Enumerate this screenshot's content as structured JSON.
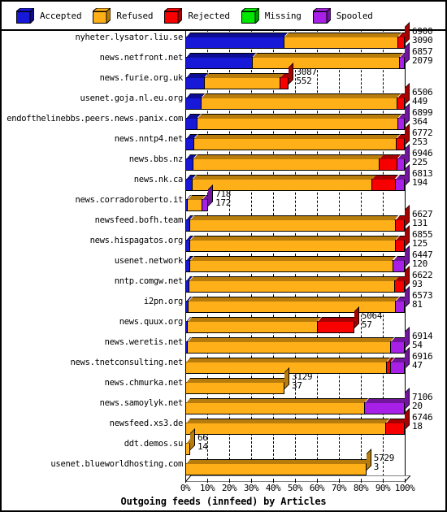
{
  "title": "Outgoing feeds (innfeed) by Articles",
  "colors": {
    "accepted": "#1818d8",
    "accepted_dark": "#0d0d93",
    "refused": "#ffb018",
    "refused_dark": "#b87c0c",
    "rejected": "#f80000",
    "rejected_dark": "#a80000",
    "missing": "#00e800",
    "missing_dark": "#009c00",
    "spooled": "#a820e8",
    "spooled_dark": "#70159c",
    "background": "#ffffff",
    "outline": "#000000"
  },
  "legend": {
    "items": [
      {
        "label": "Accepted",
        "key": "accepted"
      },
      {
        "label": "Refused",
        "key": "refused"
      },
      {
        "label": "Rejected",
        "key": "rejected"
      },
      {
        "label": "Missing",
        "key": "missing"
      },
      {
        "label": "Spooled",
        "key": "spooled"
      }
    ]
  },
  "chart_data": {
    "type": "bar",
    "orientation": "horizontal",
    "stacked": true,
    "title": "Outgoing feeds (innfeed) by Articles",
    "xlabel": "",
    "ylabel": "",
    "xlim": [
      0,
      100
    ],
    "x_tick_labels": [
      "0%",
      "10%",
      "20%",
      "30%",
      "40%",
      "50%",
      "60%",
      "70%",
      "80%",
      "90%",
      "100%"
    ],
    "x_tick_values": [
      0,
      10,
      20,
      30,
      40,
      50,
      60,
      70,
      80,
      90,
      100
    ],
    "grid": true,
    "legend_position": "top",
    "series_names": [
      "Accepted",
      "Refused",
      "Rejected",
      "Missing",
      "Spooled"
    ],
    "categories": [
      "nyheter.lysator.liu.se",
      "news.netfront.net",
      "news.furie.org.uk",
      "usenet.goja.nl.eu.org",
      "endofthelinebbs.peers.news.panix.com",
      "news.nntp4.net",
      "news.bbs.nz",
      "news.nk.ca",
      "news.corradoroberto.it",
      "newsfeed.bofh.team",
      "news.hispagatos.org",
      "usenet.network",
      "nntp.comgw.net",
      "i2pn.org",
      "news.quux.org",
      "news.weretis.net",
      "news.tnetconsulting.net",
      "news.chmurka.net",
      "news.samoylyk.net",
      "newsfeed.xs3.de",
      "ddt.demos.su",
      "usenet.blueworldhosting.com"
    ],
    "rows": [
      {
        "label": "nyheter.lysator.liu.se",
        "total": 6900,
        "secondary": 3090,
        "pct": 100.0,
        "segments": [
          {
            "key": "accepted",
            "pct": 44.8
          },
          {
            "key": "refused",
            "pct": 51.7
          },
          {
            "key": "rejected",
            "pct": 3.5
          }
        ]
      },
      {
        "label": "news.netfront.net",
        "total": 6857,
        "secondary": 2079,
        "pct": 100.0,
        "segments": [
          {
            "key": "accepted",
            "pct": 30.3
          },
          {
            "key": "refused",
            "pct": 67.2
          },
          {
            "key": "spooled",
            "pct": 2.5
          }
        ]
      },
      {
        "label": "news.furie.org.uk",
        "total": 3087,
        "secondary": 552,
        "pct": 47.2,
        "segments": [
          {
            "key": "accepted",
            "pct": 17.9
          },
          {
            "key": "refused",
            "pct": 73.5
          },
          {
            "key": "rejected",
            "pct": 8.6
          }
        ]
      },
      {
        "label": "usenet.goja.nl.eu.org",
        "total": 6506,
        "secondary": 449,
        "pct": 100.0,
        "segments": [
          {
            "key": "accepted",
            "pct": 6.9
          },
          {
            "key": "refused",
            "pct": 89.4
          },
          {
            "key": "rejected",
            "pct": 3.7
          }
        ]
      },
      {
        "label": "endofthelinebbs.peers.news.panix.com",
        "total": 6899,
        "secondary": 364,
        "pct": 100.0,
        "segments": [
          {
            "key": "accepted",
            "pct": 5.3
          },
          {
            "key": "refused",
            "pct": 91.4
          },
          {
            "key": "spooled",
            "pct": 3.3
          }
        ]
      },
      {
        "label": "news.nntp4.net",
        "total": 6772,
        "secondary": 253,
        "pct": 100.0,
        "segments": [
          {
            "key": "accepted",
            "pct": 3.7
          },
          {
            "key": "refused",
            "pct": 92.1
          },
          {
            "key": "rejected",
            "pct": 4.2
          }
        ]
      },
      {
        "label": "news.bbs.nz",
        "total": 6946,
        "secondary": 225,
        "pct": 100.0,
        "segments": [
          {
            "key": "accepted",
            "pct": 3.2
          },
          {
            "key": "refused",
            "pct": 85.0
          },
          {
            "key": "rejected",
            "pct": 8.0
          },
          {
            "key": "spooled",
            "pct": 3.8
          }
        ]
      },
      {
        "label": "news.nk.ca",
        "total": 6813,
        "secondary": 194,
        "pct": 100.0,
        "segments": [
          {
            "key": "accepted",
            "pct": 2.8
          },
          {
            "key": "refused",
            "pct": 82.2
          },
          {
            "key": "rejected",
            "pct": 10.5
          },
          {
            "key": "spooled",
            "pct": 4.5
          }
        ]
      },
      {
        "label": "news.corradoroberto.it",
        "total": 718,
        "secondary": 172,
        "pct": 10.4,
        "segments": [
          {
            "key": "accepted",
            "pct": 2.5
          },
          {
            "key": "refused",
            "pct": 67.5
          },
          {
            "key": "spooled",
            "pct": 30.0
          }
        ]
      },
      {
        "label": "newsfeed.bofh.team",
        "total": 6627,
        "secondary": 131,
        "pct": 100.0,
        "segments": [
          {
            "key": "accepted",
            "pct": 2.0
          },
          {
            "key": "refused",
            "pct": 93.5
          },
          {
            "key": "rejected",
            "pct": 4.5
          }
        ]
      },
      {
        "label": "news.hispagatos.org",
        "total": 6855,
        "secondary": 125,
        "pct": 100.0,
        "segments": [
          {
            "key": "accepted",
            "pct": 1.8
          },
          {
            "key": "refused",
            "pct": 93.8
          },
          {
            "key": "rejected",
            "pct": 4.4
          }
        ]
      },
      {
        "label": "usenet.network",
        "total": 6447,
        "secondary": 120,
        "pct": 100.0,
        "segments": [
          {
            "key": "accepted",
            "pct": 1.9
          },
          {
            "key": "refused",
            "pct": 92.4
          },
          {
            "key": "spooled",
            "pct": 5.7
          }
        ]
      },
      {
        "label": "nntp.comgw.net",
        "total": 6622,
        "secondary": 93,
        "pct": 100.0,
        "segments": [
          {
            "key": "accepted",
            "pct": 1.4
          },
          {
            "key": "refused",
            "pct": 93.9
          },
          {
            "key": "rejected",
            "pct": 4.7
          }
        ]
      },
      {
        "label": "i2pn.org",
        "total": 6573,
        "secondary": 81,
        "pct": 100.0,
        "segments": [
          {
            "key": "accepted",
            "pct": 1.2
          },
          {
            "key": "refused",
            "pct": 94.3
          },
          {
            "key": "spooled",
            "pct": 4.5
          }
        ]
      },
      {
        "label": "news.quux.org",
        "total": 5064,
        "secondary": 57,
        "pct": 77.0,
        "segments": [
          {
            "key": "accepted",
            "pct": 1.1
          },
          {
            "key": "refused",
            "pct": 76.9
          },
          {
            "key": "rejected",
            "pct": 22.0
          }
        ]
      },
      {
        "label": "news.weretis.net",
        "total": 6914,
        "secondary": 54,
        "pct": 100.0,
        "segments": [
          {
            "key": "accepted",
            "pct": 0.8
          },
          {
            "key": "refused",
            "pct": 92.7
          },
          {
            "key": "spooled",
            "pct": 6.5
          }
        ]
      },
      {
        "label": "news.tnetconsulting.net",
        "total": 6916,
        "secondary": 47,
        "pct": 100.0,
        "segments": [
          {
            "key": "refused",
            "pct": 91.5
          },
          {
            "key": "rejected",
            "pct": 2.0
          },
          {
            "key": "spooled",
            "pct": 6.5
          }
        ]
      },
      {
        "label": "news.chmurka.net",
        "total": 3129,
        "secondary": 37,
        "pct": 45.2,
        "segments": [
          {
            "key": "refused",
            "pct": 100.0
          }
        ]
      },
      {
        "label": "news.samoylyk.net",
        "total": 7106,
        "secondary": 20,
        "pct": 100.0,
        "segments": [
          {
            "key": "refused",
            "pct": 81.5
          },
          {
            "key": "spooled",
            "pct": 18.5
          }
        ]
      },
      {
        "label": "newsfeed.xs3.de",
        "total": 6746,
        "secondary": 18,
        "pct": 100.0,
        "segments": [
          {
            "key": "refused",
            "pct": 91.0
          },
          {
            "key": "rejected",
            "pct": 9.0
          }
        ]
      },
      {
        "label": "ddt.demos.su",
        "total": 66,
        "secondary": 14,
        "pct": 2.2,
        "segments": [
          {
            "key": "refused",
            "pct": 100.0
          }
        ]
      },
      {
        "label": "usenet.blueworldhosting.com",
        "total": 5729,
        "secondary": 3,
        "pct": 82.5,
        "segments": [
          {
            "key": "refused",
            "pct": 100.0
          }
        ]
      }
    ]
  }
}
